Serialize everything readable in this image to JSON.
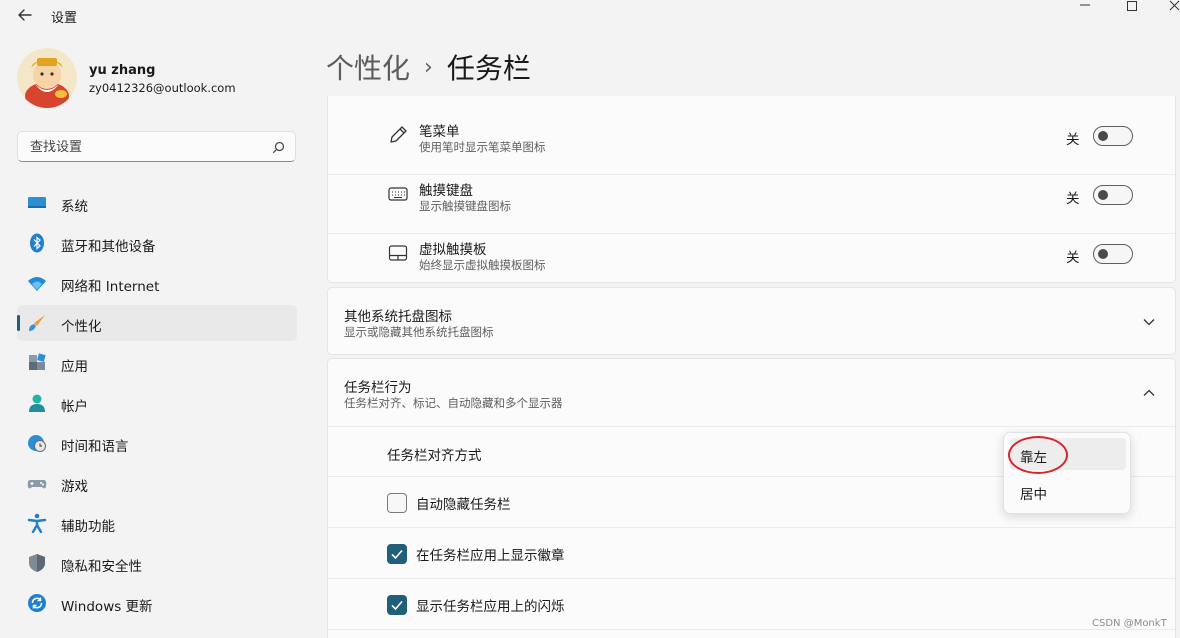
{
  "window": {
    "title": "设置"
  },
  "account": {
    "name": "yu zhang",
    "email": "zy0412326@outlook.com"
  },
  "search": {
    "placeholder": "查找设置"
  },
  "nav": {
    "items": [
      {
        "label": "系统",
        "icon": "monitor-icon"
      },
      {
        "label": "蓝牙和其他设备",
        "icon": "bluetooth-icon"
      },
      {
        "label": "网络和 Internet",
        "icon": "wifi-icon"
      },
      {
        "label": "个性化",
        "icon": "brush-icon",
        "active": true
      },
      {
        "label": "应用",
        "icon": "apps-icon"
      },
      {
        "label": "帐户",
        "icon": "person-icon"
      },
      {
        "label": "时间和语言",
        "icon": "globe-clock-icon"
      },
      {
        "label": "游戏",
        "icon": "gamepad-icon"
      },
      {
        "label": "辅助功能",
        "icon": "accessibility-icon"
      },
      {
        "label": "隐私和安全性",
        "icon": "shield-icon"
      },
      {
        "label": "Windows 更新",
        "icon": "update-icon"
      }
    ]
  },
  "header": {
    "parent": "个性化",
    "separator": "›",
    "current": "任务栏"
  },
  "taskbar_icons": {
    "rows": [
      {
        "title": "笔菜单",
        "subtitle": "使用笔时显示笔菜单图标",
        "state": "关",
        "on": false,
        "icon": "pen-icon"
      },
      {
        "title": "触摸键盘",
        "subtitle": "显示触摸键盘图标",
        "state": "关",
        "on": false,
        "icon": "keyboard-icon"
      },
      {
        "title": "虚拟触摸板",
        "subtitle": "始终显示虚拟触摸板图标",
        "state": "关",
        "on": false,
        "icon": "touchpad-icon"
      }
    ]
  },
  "tray": {
    "title": "其他系统托盘图标",
    "subtitle": "显示或隐藏其他系统托盘图标",
    "expanded": false
  },
  "behaviors": {
    "title": "任务栏行为",
    "subtitle": "任务栏对齐、标记、自动隐藏和多个显示器",
    "expanded": true,
    "alignment_label": "任务栏对齐方式",
    "alignment_options": [
      "靠左",
      "居中"
    ],
    "alignment_selected": "靠左",
    "checkboxes": [
      {
        "label": "自动隐藏任务栏",
        "checked": false
      },
      {
        "label": "在任务栏应用上显示徽章",
        "checked": true
      },
      {
        "label": "显示任务栏应用上的闪烁",
        "checked": true
      }
    ]
  },
  "watermark": "CSDN @MonkT",
  "colors": {
    "accent": "#1f5f7a",
    "annotation": "#d9262a",
    "background": "#f3f3f3",
    "card": "#fbfbfb"
  }
}
